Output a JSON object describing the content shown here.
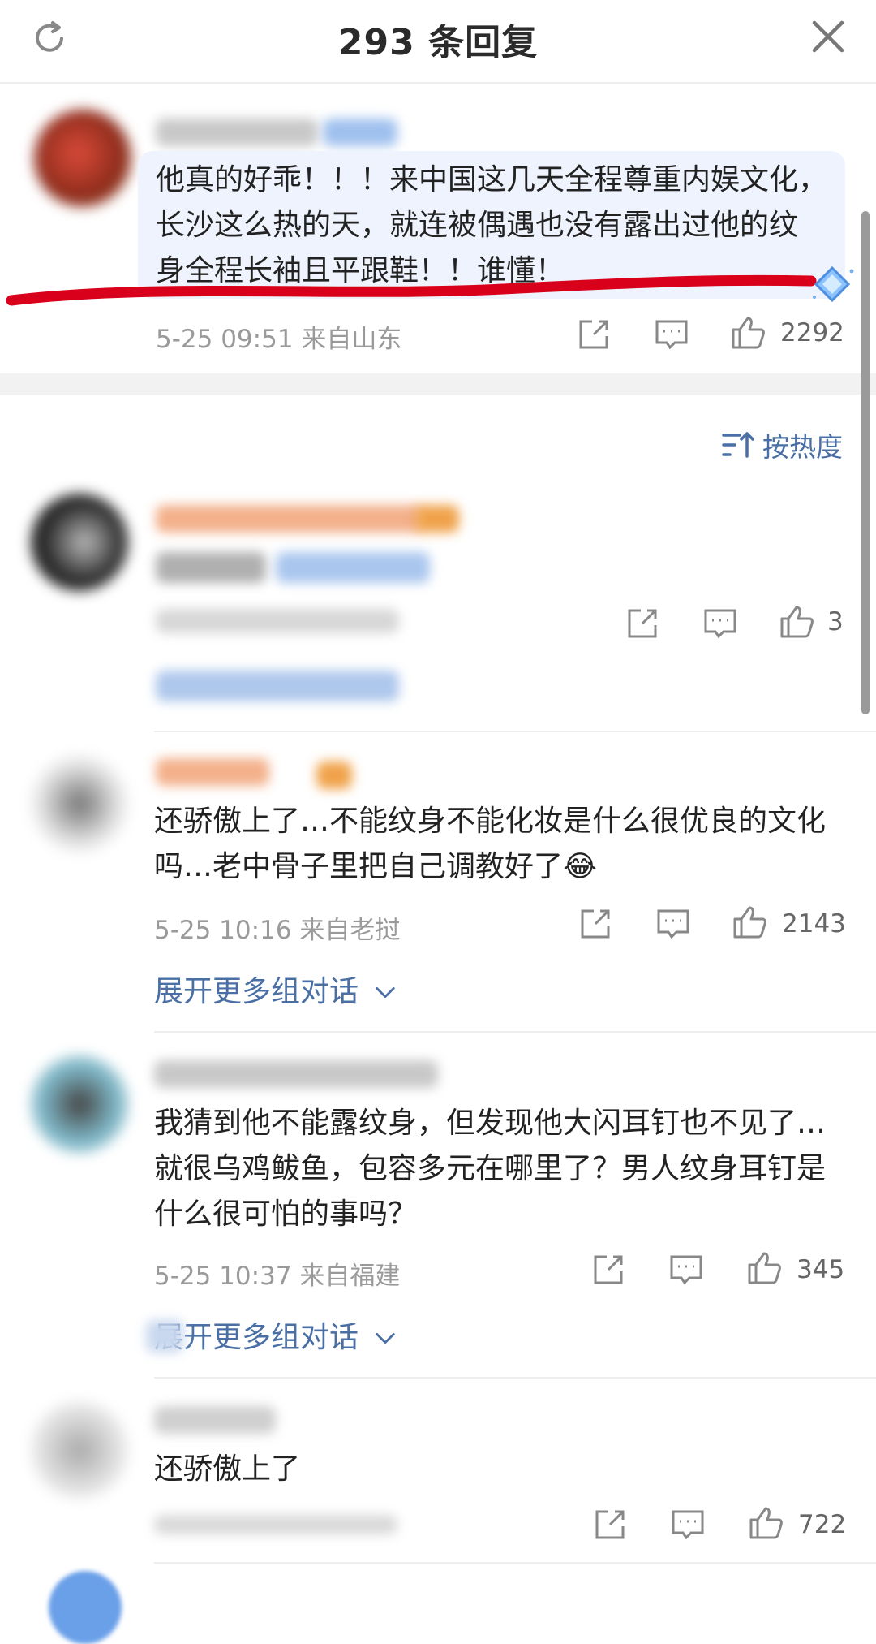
{
  "header": {
    "title": "293 条回复"
  },
  "top_comment": {
    "lines": [
      "他真的好乖！！！来中国这几天全程尊重内娱文化，",
      "长沙这么热的天，就连被偶遇也没有露出过他的纹",
      "身全程长袖且平跟鞋！！谁懂！"
    ],
    "meta": "5-25 09:51 来自山东",
    "likes": "2292"
  },
  "sort": {
    "label": "按热度"
  },
  "replies": [
    {
      "meta": "",
      "likes": "3",
      "expand_label": ""
    },
    {
      "lines": [
        "还骄傲上了…不能纹身不能化妆是什么很优良的文化",
        "吗…老中骨子里把自己调教好了😂"
      ],
      "meta": "5-25 10:16 来自老挝",
      "likes": "2143",
      "expand_label": "展开更多组对话"
    },
    {
      "lines": [
        "我猜到他不能露纹身，但发现他大闪耳钉也不见了…",
        "就很乌鸡鲅鱼，包容多元在哪里了？男人纹身耳钉是",
        "什么很可怕的事吗？"
      ],
      "meta": "5-25 10:37 来自福建",
      "likes": "345",
      "expand_label": "展开更多组对话"
    },
    {
      "lines": [
        "还骄傲上了"
      ],
      "meta": "",
      "likes": "722"
    }
  ],
  "icons": {
    "refresh": "refresh-icon",
    "close": "close-icon",
    "share": "share-icon",
    "comment": "comment-icon",
    "like": "thumbs-up-icon",
    "sort": "sort-icon",
    "chevron": "chevron-down-icon"
  },
  "colors": {
    "link": "#4a6fa5",
    "highlight_bg": "#eef3fd",
    "annotation_red": "#d9001b"
  }
}
